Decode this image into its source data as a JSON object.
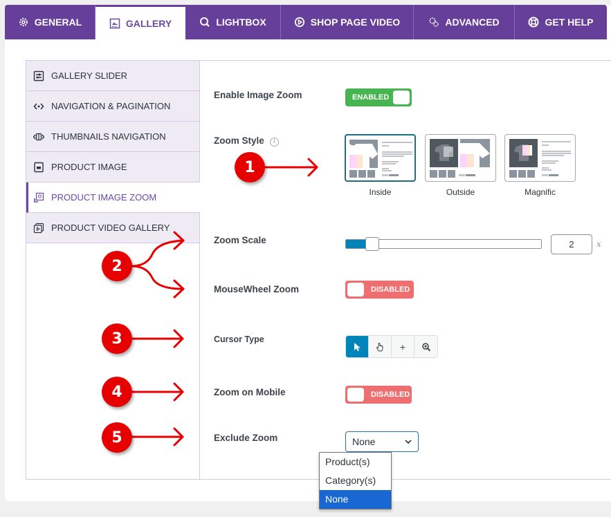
{
  "tabs": [
    {
      "label": "GENERAL",
      "icon": "gear-icon",
      "active": false
    },
    {
      "label": "GALLERY",
      "icon": "gallery-icon",
      "active": true
    },
    {
      "label": "LIGHTBOX",
      "icon": "search-icon",
      "active": false
    },
    {
      "label": "SHOP PAGE VIDEO",
      "icon": "play-circle-icon",
      "active": false
    },
    {
      "label": "ADVANCED",
      "icon": "gears-icon",
      "active": false
    },
    {
      "label": "GET HELP",
      "icon": "lifebuoy-icon",
      "active": false
    }
  ],
  "sidebar": {
    "items": [
      {
        "label": "GALLERY SLIDER",
        "icon": "sliders-icon"
      },
      {
        "label": "NAVIGATION & PAGINATION",
        "icon": "code-arrows-icon"
      },
      {
        "label": "THUMBNAILS NAVIGATION",
        "icon": "thumbnail-nav-icon"
      },
      {
        "label": "PRODUCT IMAGE",
        "icon": "image-frame-icon"
      },
      {
        "label": "PRODUCT IMAGE ZOOM",
        "icon": "zoom-image-icon",
        "active": true
      },
      {
        "label": "PRODUCT VIDEO GALLERY",
        "icon": "video-gallery-icon"
      }
    ]
  },
  "settings": {
    "enable_zoom": {
      "label": "Enable Image Zoom",
      "state": "ENABLED"
    },
    "zoom_style": {
      "label": "Zoom Style",
      "info_icon": "i",
      "options": [
        {
          "label": "Inside",
          "selected": true
        },
        {
          "label": "Outside",
          "selected": false
        },
        {
          "label": "Magnific",
          "selected": false
        }
      ]
    },
    "zoom_scale": {
      "label": "Zoom Scale",
      "value": "2",
      "unit": "x",
      "slider_fraction": 0.1
    },
    "mousewheel_zoom": {
      "label": "MouseWheel Zoom",
      "state": "DISABLED"
    },
    "cursor_type": {
      "label": "Cursor Type",
      "options": [
        {
          "name": "arrow-cursor",
          "active": true
        },
        {
          "name": "hand-cursor",
          "active": false
        },
        {
          "name": "crosshair-cursor",
          "symbol": "+",
          "active": false
        },
        {
          "name": "zoom-in-cursor",
          "active": false
        }
      ]
    },
    "zoom_on_mobile": {
      "label": "Zoom on Mobile",
      "state": "DISABLED"
    },
    "exclude_zoom": {
      "label": "Exclude Zoom",
      "value": "None",
      "options": [
        "Product(s)",
        "Category(s)",
        "None"
      ],
      "selected_index": 2
    }
  },
  "annotations": [
    "1",
    "2",
    "3",
    "4",
    "5"
  ],
  "colors": {
    "brand": "#663f9a",
    "enabled": "#46b450",
    "disabled": "#ed6f6f",
    "accent": "#0085ba",
    "annotation": "#e60000"
  }
}
